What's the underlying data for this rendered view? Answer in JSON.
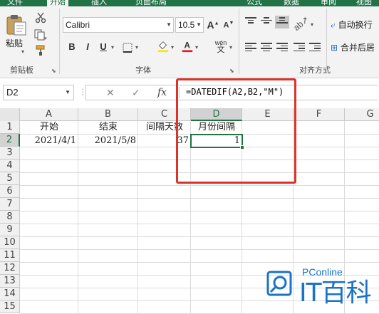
{
  "ribbon": {
    "tabs": [
      "文件",
      "开始",
      "插入",
      "页面布局",
      "公式",
      "数据",
      "审阅",
      "视图"
    ],
    "active_tab": "开始",
    "clipboard": {
      "paste_label": "粘贴",
      "group_label": "剪贴板"
    },
    "font": {
      "name": "Calibri",
      "size": "10.5",
      "group_label": "字体",
      "bold": "B",
      "italic": "I",
      "underline": "U",
      "phonetic_top": "wén",
      "phonetic_bottom": "文"
    },
    "alignment": {
      "group_label": "对齐方式"
    },
    "right_buttons": {
      "wrap_label": "自动换行",
      "merge_label": "合并后居"
    }
  },
  "formula_bar": {
    "name_box": "D2",
    "cancel_symbol": "✕",
    "enter_symbol": "✓",
    "fx_symbol": "fx",
    "formula": "=DATEDIF(A2,B2,\"M\")"
  },
  "sheet": {
    "columns": [
      "A",
      "B",
      "C",
      "D",
      "E",
      "F",
      "G"
    ],
    "selected_column": "D",
    "rows": [
      "1",
      "2",
      "3",
      "4",
      "5",
      "6",
      "7",
      "8",
      "9",
      "10",
      "11",
      "12",
      "13",
      "14",
      "15"
    ],
    "selected_row": "2",
    "cells": {
      "A1": "开始",
      "B1": "结束",
      "C1": "间隔天数",
      "D1": "月份间隔",
      "A2": "2021/4/1",
      "B2": "2021/5/8",
      "C2": "37",
      "D2": "1"
    }
  },
  "colors": {
    "accent": "#217346",
    "highlight": "#d9342b",
    "watermark": "#1a73c7"
  },
  "watermark": {
    "brand_top": "PConline",
    "brand_main": "IT百科"
  }
}
